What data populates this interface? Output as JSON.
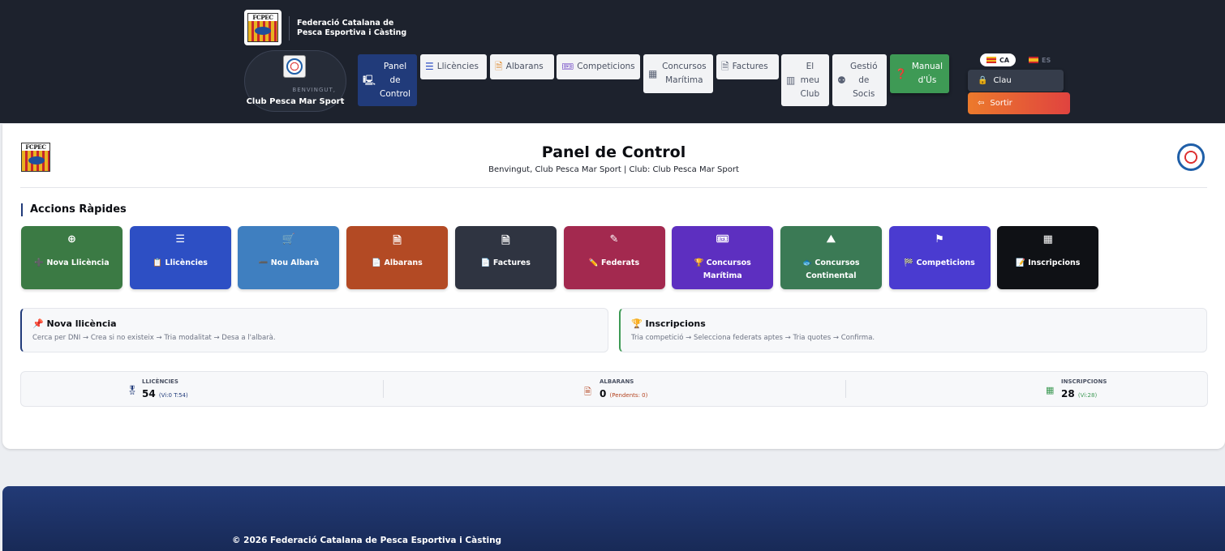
{
  "header": {
    "logo_text": "FCPEC",
    "federation_name": "Federació Catalana de Pesca Esportiva i Càsting",
    "welcome_label": "BENVINGUT,",
    "club_name": "Club Pesca Mar Sport",
    "nav": [
      {
        "label": "Panel de Control",
        "icon": "dashboard-icon"
      },
      {
        "label": "Llicències",
        "icon": "list-icon"
      },
      {
        "label": "Albarans",
        "icon": "document-icon"
      },
      {
        "label": "Competicions",
        "icon": "tickets-icon"
      },
      {
        "label": "Concursos Marítima",
        "icon": "calendar-icon"
      },
      {
        "label": "Factures",
        "icon": "invoice-icon"
      },
      {
        "label": "El meu Club",
        "icon": "building-icon"
      },
      {
        "label": "Gestió de Socis",
        "icon": "users-icon"
      },
      {
        "label": "Manual d'Ús",
        "icon": "help-icon"
      }
    ],
    "languages": [
      "CA",
      "ES"
    ],
    "password_label": "Clau",
    "logout_label": "Sortir"
  },
  "main": {
    "title": "Panel de Control",
    "subtitle": "Benvingut, Club Pesca Mar Sport | Club: Club Pesca Mar Sport",
    "quick_actions_title": "Accions Ràpides",
    "tiles": [
      {
        "icon": "⊕",
        "label": "➕ Nova Llicència",
        "color": "#3b7a44"
      },
      {
        "icon": "☰",
        "label": "📋 Llicències",
        "color": "#2d4fc4"
      },
      {
        "icon": "🛒",
        "label": "➖ Nou Albarà",
        "color": "#3f7fc0"
      },
      {
        "icon": "🗎",
        "label": "📄 Albarans",
        "color": "#b34a24"
      },
      {
        "icon": "🗎",
        "label": "📄 Factures",
        "color": "#2f3441"
      },
      {
        "icon": "✎",
        "label": "✏️ Federats",
        "color": "#a3294f"
      },
      {
        "icon": "🎟",
        "label": "🏆 Concursos Marítima",
        "color": "#5d2fc0"
      },
      {
        "icon": "⛰",
        "label": "🐟 Concursos Continental",
        "color": "#3b7a55"
      },
      {
        "icon": "⚑",
        "label": "🏁 Competicions",
        "color": "#4a3bd0"
      },
      {
        "icon": "▦",
        "label": "📝 Inscripcions",
        "color": "#0f1115"
      }
    ],
    "info_cards": [
      {
        "title": "📌 Nova llicència",
        "description": "Cerca per DNI → Crea si no existeix → Tria modalitat → Desa a l'albarà."
      },
      {
        "title": "🏆 Inscripcions",
        "description": "Tria competició → Selecciona federats aptes → Tria quotes → Confirma."
      }
    ],
    "stats": [
      {
        "icon": "🎖",
        "label": "LLICÈNCIES",
        "value": "54",
        "detail": "(Vi:0 T:54)",
        "detail_color": "#213b7a"
      },
      {
        "icon": "🗎",
        "label": "ALBARANS",
        "value": "0",
        "detail": "(Pendents: 0)",
        "detail_color": "#b3431f"
      },
      {
        "icon": "▦",
        "label": "INSCRIPCIONS",
        "value": "28",
        "detail": "(Vi:28)",
        "detail_color": "#3e9a55"
      }
    ]
  },
  "footer": {
    "copyright": "© 2026 Federació Catalana de Pesca Esportiva i Càsting"
  }
}
